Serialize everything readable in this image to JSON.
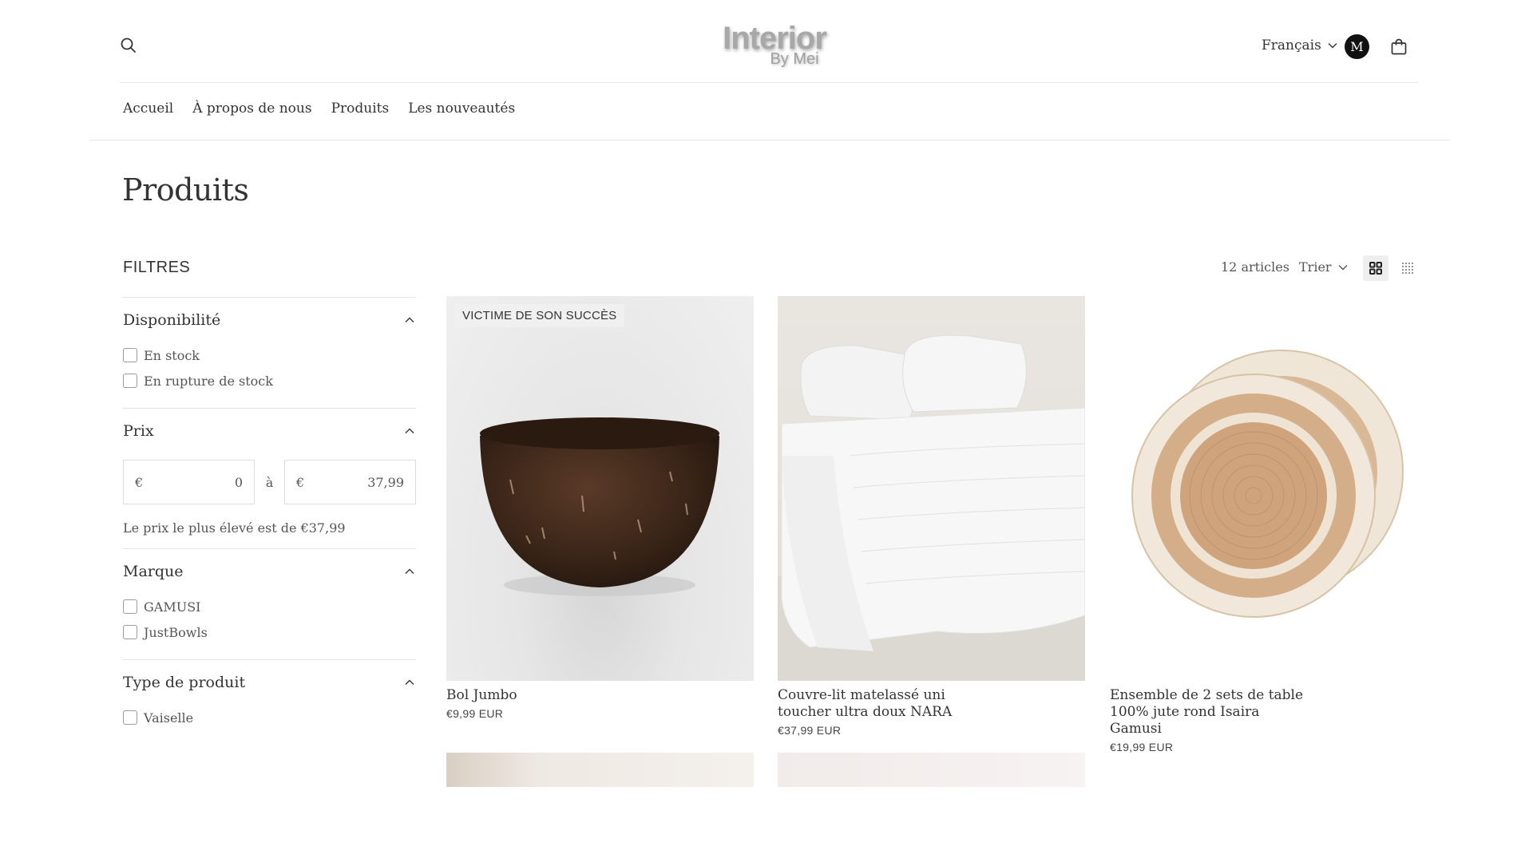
{
  "header": {
    "logo_text": "Interior",
    "logo_subtext": "By Mei",
    "language": "Français",
    "avatar_initial": "M"
  },
  "nav": {
    "items": [
      {
        "label": "Accueil"
      },
      {
        "label": "À propos de nous"
      },
      {
        "label": "Produits"
      },
      {
        "label": "Les nouveautés"
      }
    ]
  },
  "page": {
    "title": "Produits"
  },
  "filters": {
    "title": "FILTRES",
    "availability": {
      "label": "Disponibilité",
      "options": [
        {
          "label": "En stock",
          "checked": false
        },
        {
          "label": "En rupture de stock",
          "checked": false
        }
      ]
    },
    "price": {
      "label": "Prix",
      "currency": "€",
      "from_value": "0",
      "to_value": "37,99",
      "separator": "à",
      "note": "Le prix le plus élevé est de €37,99"
    },
    "brand": {
      "label": "Marque",
      "options": [
        {
          "label": "GAMUSI",
          "checked": false
        },
        {
          "label": "JustBowls",
          "checked": false
        }
      ]
    },
    "product_type": {
      "label": "Type de produit",
      "options": [
        {
          "label": "Vaiselle",
          "checked": false
        }
      ]
    }
  },
  "toolbar": {
    "count": "12 articles",
    "sort_label": "Trier"
  },
  "products": [
    {
      "title": "Bol Jumbo",
      "price": "€9,99 EUR",
      "badge": "VICTIME DE SON SUCCÈS"
    },
    {
      "title": "Couvre-lit matelassé uni toucher ultra doux NARA",
      "price": "€37,99 EUR"
    },
    {
      "title": "Ensemble de 2 sets de table 100% jute rond Isaira Gamusi",
      "price": "€19,99 EUR"
    }
  ],
  "colors": {
    "text": "#333333",
    "border": "#e4e4e4",
    "avatar_bg": "#111111"
  }
}
